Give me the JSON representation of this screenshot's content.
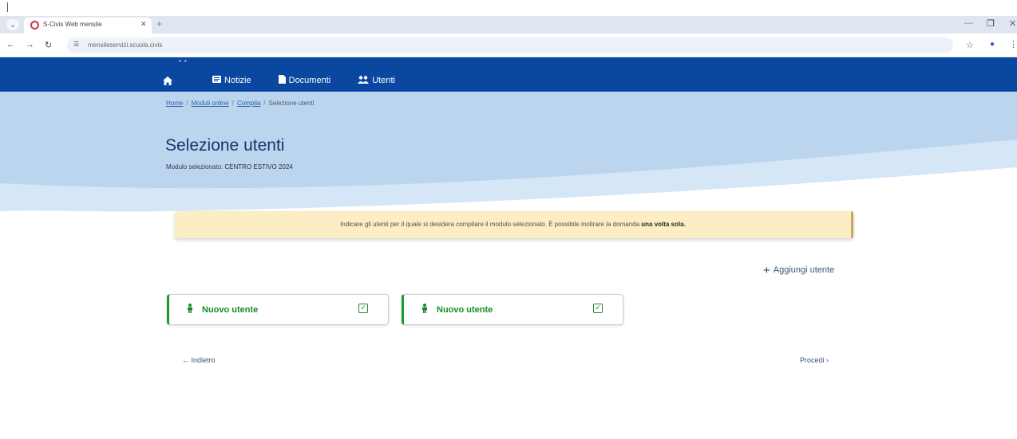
{
  "browser": {
    "tab_title": "S-Civis Web mensile",
    "url": "mensileservizi.scuola.civis",
    "icons": {
      "tab_menu": "chevron-down-icon",
      "favicon": "site-favicon-icon",
      "close": "close-icon",
      "new_tab": "plus-icon",
      "back": "arrow-left-icon",
      "forward": "arrow-right-icon",
      "reload": "reload-icon",
      "site_info": "site-info-icon",
      "bookmark": "star-icon",
      "profile": "profile-icon",
      "more": "more-icon"
    }
  },
  "header": {
    "home_icon": "home-icon",
    "nav": [
      {
        "label": "Notizie",
        "icon": "newspaper-icon"
      },
      {
        "label": "Documenti",
        "icon": "document-icon"
      },
      {
        "label": "Utenti",
        "icon": "users-icon"
      }
    ],
    "brand_color": "#0a47a0"
  },
  "breadcrumb": {
    "home": "Home",
    "moduli": "Moduli online",
    "compila": "Compila",
    "current": "Selezione utenti",
    "separator": "/"
  },
  "page": {
    "title": "Selezione utenti",
    "subtitle_prefix": "Modulo selezionato:",
    "subtitle_value": "CENTRO ESTIVO 2024"
  },
  "alert": {
    "text": "Indicare gli utenti per il quale si desidera compilare il modulo selezionato. È possibile inoltrare la domanda",
    "emphasis": "una volta sola."
  },
  "actions": {
    "add_user_label": "Aggiungi utente",
    "add_user_icon": "plus-icon"
  },
  "users": [
    {
      "label": "Nuovo utente",
      "icon": "person-icon",
      "checked": true
    },
    {
      "label": "Nuovo utente",
      "icon": "person-icon",
      "checked": true
    }
  ],
  "footer_nav": {
    "back_label": "← Indietro",
    "next_label": "Procedi ›"
  },
  "colors": {
    "accent_green": "#1c9a2f",
    "alert_bg": "#fbeec4"
  }
}
